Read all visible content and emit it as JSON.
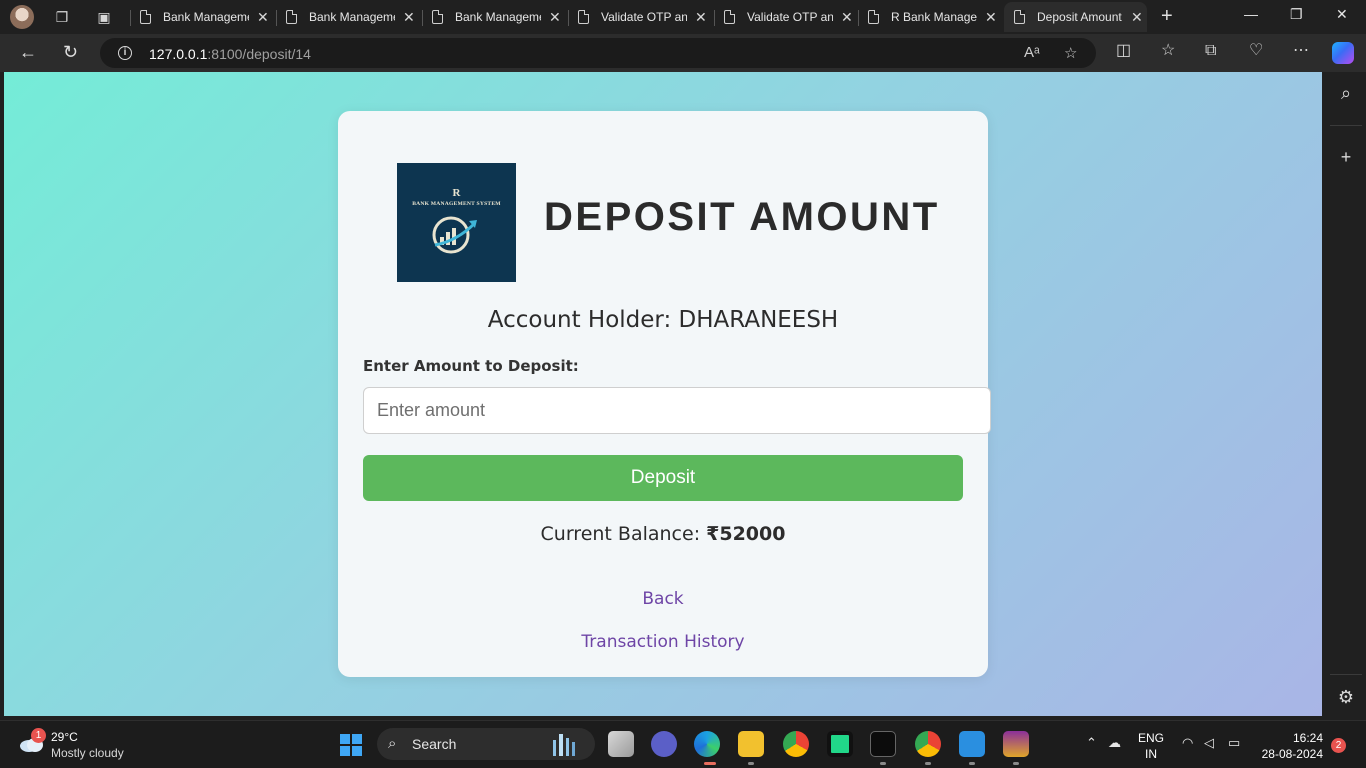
{
  "browser": {
    "tabs": [
      {
        "title": "Bank Management System"
      },
      {
        "title": "Bank Management System"
      },
      {
        "title": "Bank Management System"
      },
      {
        "title": "Validate OTP and"
      },
      {
        "title": "Validate OTP and"
      },
      {
        "title": "R Bank Management"
      },
      {
        "title": "Deposit Amount"
      }
    ],
    "url_host": "127.0.0.1",
    "url_path": ":8100/deposit/14"
  },
  "page": {
    "logo_letter": "R",
    "logo_subtitle": "BANK MANAGEMENT SYSTEM",
    "heading": "DEPOSIT AMOUNT",
    "account_holder": "Account Holder: DHARANEESH",
    "amount_label": "Enter Amount to Deposit:",
    "amount_placeholder": "Enter amount",
    "deposit_button": "Deposit",
    "balance_label": "Current Balance: ",
    "balance_value": "₹52000",
    "back_link": "Back",
    "history_link": "Transaction History"
  },
  "taskbar": {
    "weather_badge": "1",
    "temperature": "29°C",
    "condition": "Mostly cloudy",
    "search_label": "Search",
    "lang_line1": "ENG",
    "lang_line2": "IN",
    "time": "16:24",
    "date": "28-08-2024",
    "notification_count": "2"
  },
  "colors": {
    "accent_green": "#5cb85c",
    "link_purple": "#6e45a6",
    "logo_bg": "#0d3550"
  }
}
